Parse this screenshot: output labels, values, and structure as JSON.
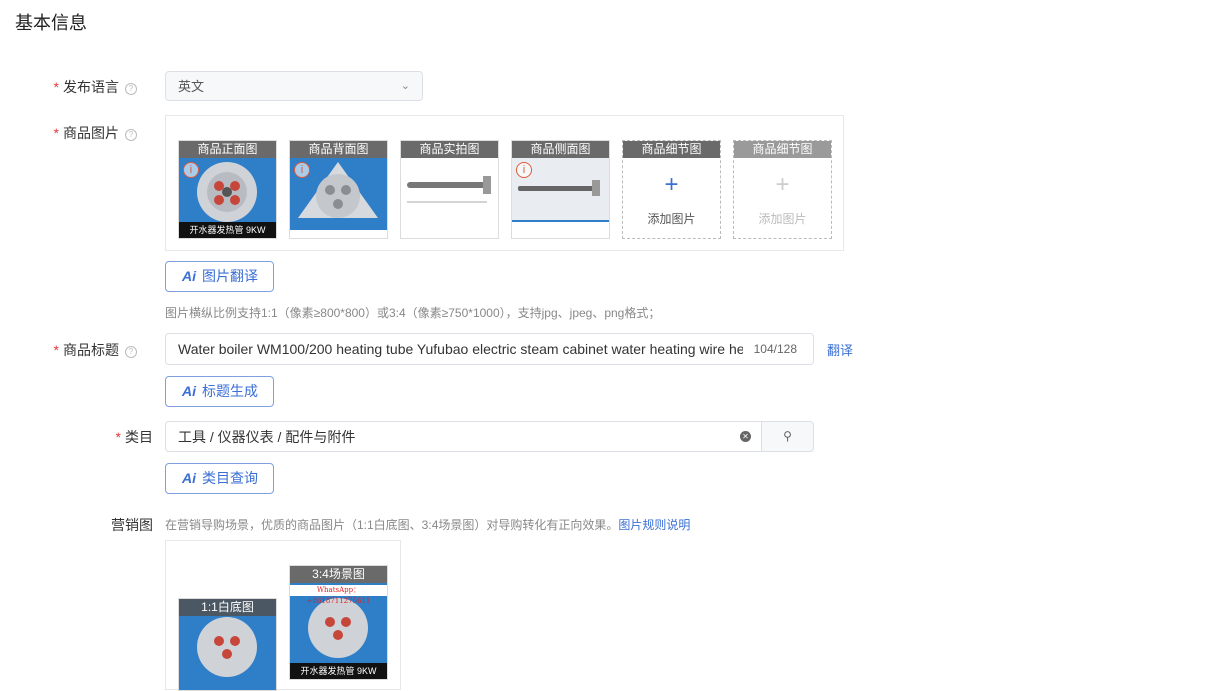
{
  "section_title": "基本信息",
  "fields": {
    "language": {
      "label": "发布语言",
      "value": "英文"
    },
    "images": {
      "label": "商品图片"
    },
    "title": {
      "label": "商品标题",
      "value": "Water boiler WM100/200 heating tube Yufubao electric steam cabinet water heating wire he",
      "count": "104/128",
      "translate": "翻译"
    },
    "category": {
      "label": "类目",
      "value": "工具 / 仪器仪表 / 配件与附件"
    },
    "marketing": {
      "label": "营销图",
      "hint": "在营销导购场景，优质的商品图片（1:1白底图、3:4场景图）对导购转化有正向效果。",
      "rules_link": "图片规则说明"
    }
  },
  "image_slots": [
    {
      "caption": "商品正面图",
      "bottom": "开水器发热管 9KW"
    },
    {
      "caption": "商品背面图"
    },
    {
      "caption": "商品实拍图"
    },
    {
      "caption": "商品侧面图"
    },
    {
      "caption": "商品细节图",
      "add": "添加图片"
    },
    {
      "caption": "商品细节图",
      "add": "添加图片"
    }
  ],
  "image_hint": "图片横纵比例支持1:1（像素≥800*800）或3:4（像素≥750*1000），支持jpg、jpeg、png格式；",
  "buttons": {
    "img_translate": "图片翻译",
    "title_gen": "标题生成",
    "category_query": "类目查询",
    "ai": "Ai"
  },
  "marketing_slots": [
    {
      "caption": "1:1白底图"
    },
    {
      "caption": "3:4场景图",
      "top_text": "WhatsApp：+8618711275611",
      "bottom": "开水器发热管 9KW"
    }
  ],
  "colors": {
    "accent": "#3b6fd6",
    "required": "#e4393c"
  }
}
